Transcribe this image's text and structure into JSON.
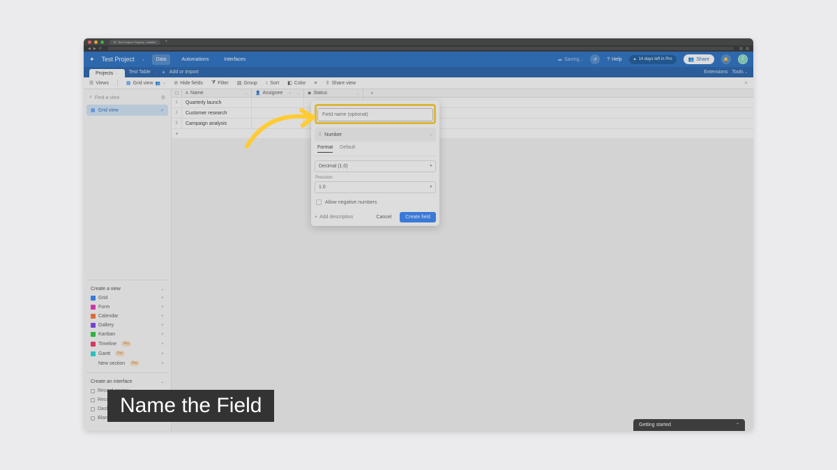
{
  "browser": {
    "tab_title": "Test Project: Projects - Airtable"
  },
  "header": {
    "project_title": "Test Project",
    "tabs": {
      "data": "Data",
      "automations": "Automations",
      "interfaces": "Interfaces"
    },
    "saving": "Saving...",
    "help": "Help",
    "trial": "14 days left in Pro",
    "share": "Share",
    "avatar_initial": "Z"
  },
  "table_tabs": {
    "projects": "Projects",
    "test_table": "Test Table",
    "add_import": "Add or import",
    "extensions": "Extensions",
    "tools": "Tools"
  },
  "toolbar": {
    "views": "Views",
    "grid_view": "Grid view",
    "hide_fields": "Hide fields",
    "filter": "Filter",
    "group": "Group",
    "sort": "Sort",
    "color": "Color",
    "share_view": "Share view"
  },
  "sidebar": {
    "find_view": "Find a view",
    "grid_view": "Grid view",
    "create_view": "Create a view",
    "view_types": {
      "grid": "Grid",
      "form": "Form",
      "calendar": "Calendar",
      "gallery": "Gallery",
      "kanban": "Kanban",
      "timeline": "Timeline",
      "gantt": "Gantt",
      "new_section": "New section"
    },
    "pro_badge": "Pro",
    "create_interface": "Create an interface",
    "interface_types": {
      "record_review": "Record review",
      "record_summary": "Record summary",
      "dashboard": "Dashboard",
      "blank": "Blank"
    }
  },
  "grid": {
    "columns": {
      "name": "Name",
      "assignee": "Assignee",
      "status": "Status"
    },
    "rows": [
      {
        "num": "1",
        "name": "Quarterly launch"
      },
      {
        "num": "2",
        "name": "Customer research"
      },
      {
        "num": "3",
        "name": "Campaign analysis"
      }
    ]
  },
  "popover": {
    "field_name_placeholder": "Field name (optional)",
    "field_type": "Number",
    "tabs": {
      "format": "Format",
      "default": "Default"
    },
    "format_value": "Decimal (1.0)",
    "precision_label": "Precision",
    "precision_value": "1.0",
    "allow_negative": "Allow negative numbers",
    "add_description": "Add description",
    "cancel": "Cancel",
    "create": "Create field"
  },
  "getting_started": "Getting started",
  "caption": "Name the Field"
}
